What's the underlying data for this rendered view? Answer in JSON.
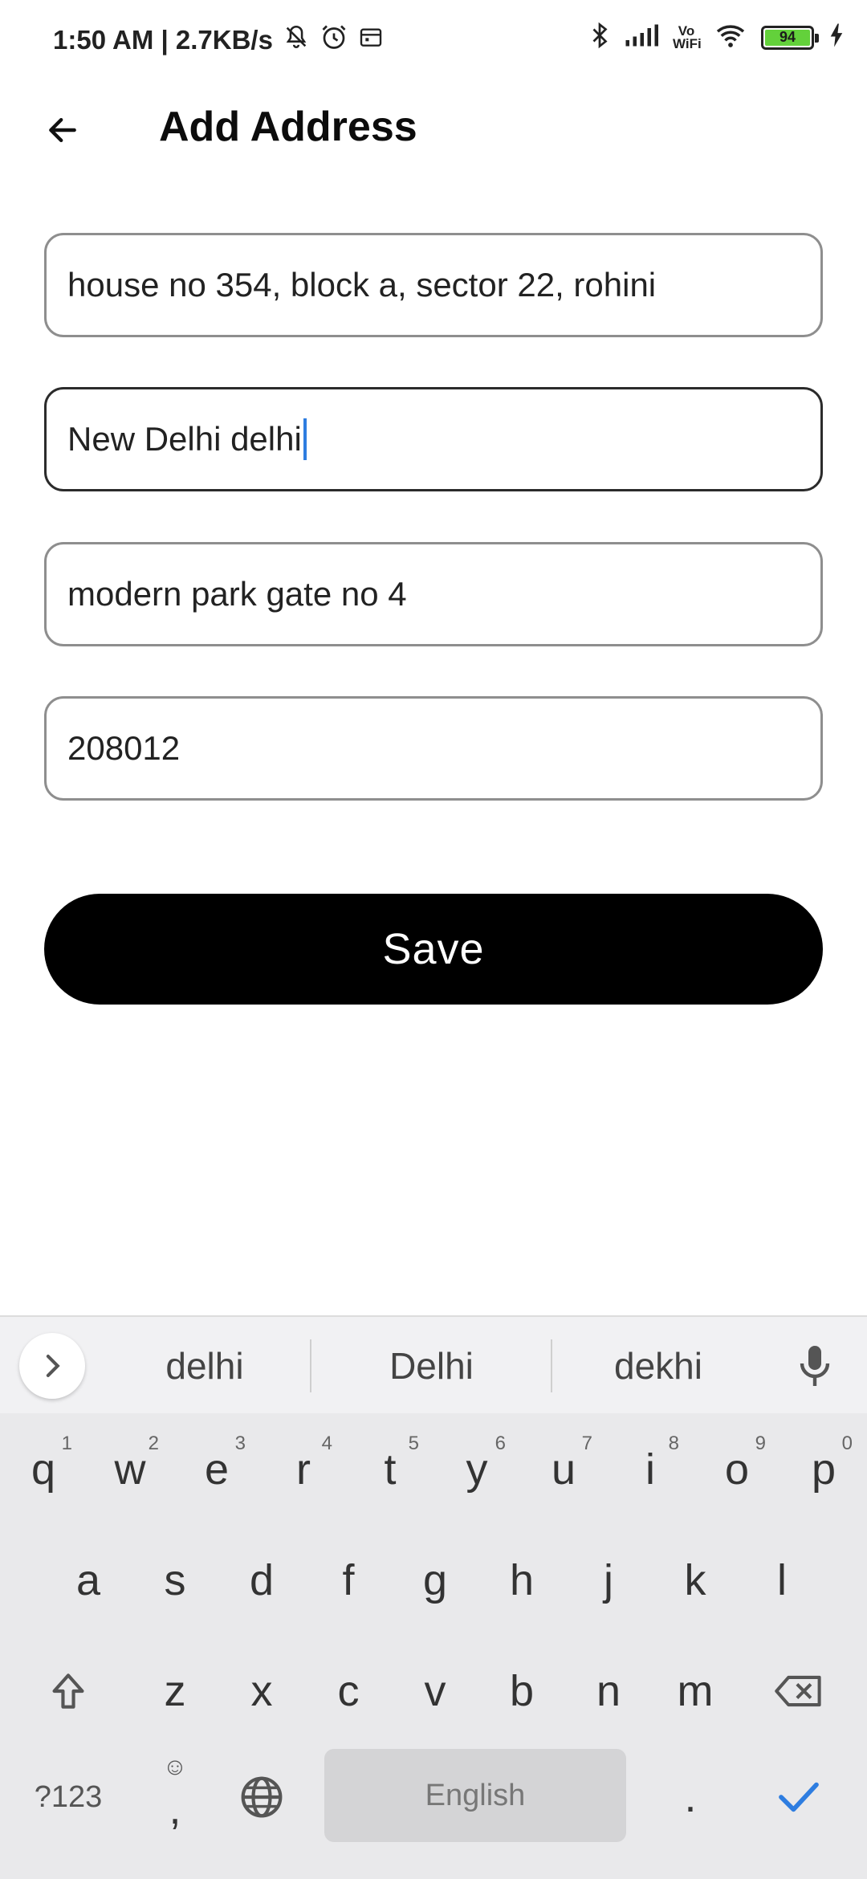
{
  "status_bar": {
    "time_speed": "1:50 AM | 2.7KB/s",
    "battery": "94",
    "network_label": "Vo WiFi"
  },
  "appbar": {
    "title": "Add Address"
  },
  "form": {
    "fields": [
      {
        "value": "house no 354, block a, sector 22, rohini"
      },
      {
        "value": "New Delhi delhi"
      },
      {
        "value": "modern park gate no 4"
      },
      {
        "value": "208012"
      }
    ],
    "save_label": "Save"
  },
  "keyboard": {
    "suggestions": [
      "delhi",
      "Delhi",
      "dekhi"
    ],
    "row1": [
      {
        "key": "q",
        "hint": "1"
      },
      {
        "key": "w",
        "hint": "2"
      },
      {
        "key": "e",
        "hint": "3"
      },
      {
        "key": "r",
        "hint": "4"
      },
      {
        "key": "t",
        "hint": "5"
      },
      {
        "key": "y",
        "hint": "6"
      },
      {
        "key": "u",
        "hint": "7"
      },
      {
        "key": "i",
        "hint": "8"
      },
      {
        "key": "o",
        "hint": "9"
      },
      {
        "key": "p",
        "hint": "0"
      }
    ],
    "row2": [
      "a",
      "s",
      "d",
      "f",
      "g",
      "h",
      "j",
      "k",
      "l"
    ],
    "row3": [
      "z",
      "x",
      "c",
      "v",
      "b",
      "n",
      "m"
    ],
    "symbols_label": "?123",
    "comma_label": ",",
    "space_label": "English",
    "period_label": "."
  },
  "colors": {
    "accent": "#2e7de0",
    "save_bg": "#000000",
    "keyboard_bg": "#e9e9eb",
    "battery_fill": "#63d13b"
  }
}
